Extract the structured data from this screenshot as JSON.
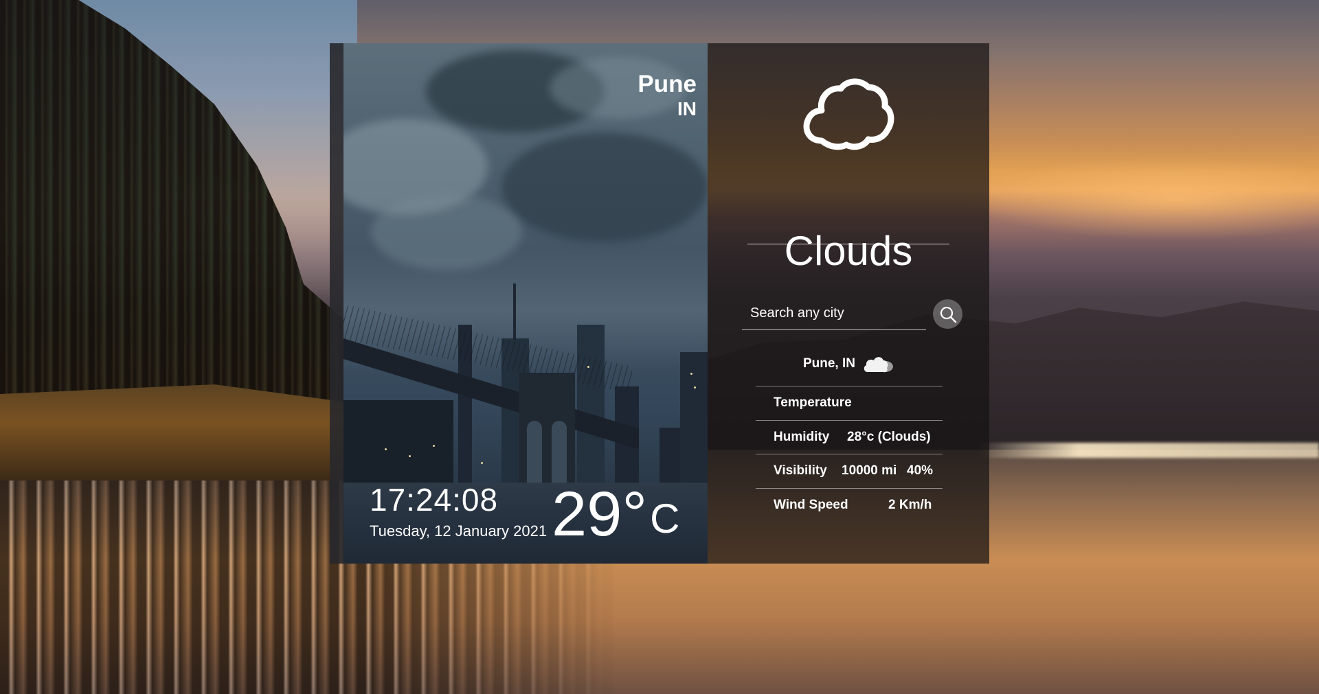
{
  "location": {
    "city": "Pune",
    "country": "IN"
  },
  "clock": {
    "time": "17:24:08",
    "date": "Tuesday, 12 January 2021"
  },
  "temperature": {
    "value": "29°",
    "unit": "C"
  },
  "weather": {
    "icon": "cloud-outline-icon",
    "condition": "Clouds"
  },
  "search": {
    "placeholder": "Search any city",
    "value": ""
  },
  "forecast": {
    "location_label": "Pune, IN",
    "location_icon": "small-cloud-icon",
    "rows": [
      {
        "label": "Temperature",
        "value": ""
      },
      {
        "label": "Humidity",
        "value": "28°c (Clouds)"
      },
      {
        "label": "Visibility",
        "value": "10000 mi",
        "extra": "40%"
      },
      {
        "label": "Wind Speed",
        "value": "2 Km/h"
      }
    ]
  },
  "colors": {
    "panel": "#161414",
    "text": "#ffffff",
    "search_button": "#969696"
  }
}
